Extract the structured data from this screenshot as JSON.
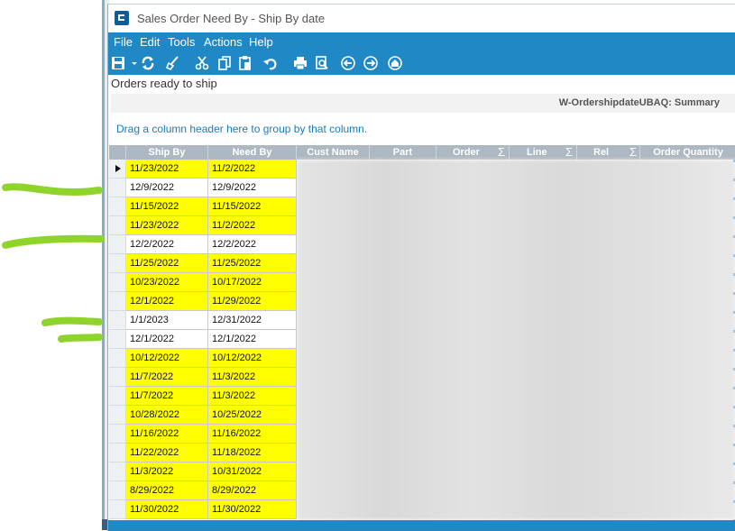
{
  "window": {
    "title": "Sales Order Need By - Ship By date"
  },
  "menu": [
    "File",
    "Edit",
    "Tools",
    "Actions",
    "Help"
  ],
  "toolbar_icons": [
    "save-icon",
    "dropdown-icon",
    "refresh-icon",
    "clear-icon",
    "cut-icon",
    "copy-icon",
    "paste-icon",
    "undo-icon",
    "print-icon",
    "print-preview-icon",
    "back-icon",
    "forward-icon",
    "home-icon"
  ],
  "panel": {
    "orders_label": "Orders ready to ship",
    "summary_label": "W-OrdershipdateUBAQ: Summary",
    "group_hint": "Drag a column header here to group by that column."
  },
  "grid": {
    "columns": [
      "Ship By",
      "Need By",
      "Cust Name",
      "Part",
      "Order",
      "Line",
      "Rel",
      "Order Quantity"
    ],
    "rows": [
      {
        "ship_by": "11/23/2022",
        "need_by": "11/2/2022",
        "highlight": true
      },
      {
        "ship_by": "12/9/2022",
        "need_by": "12/9/2022",
        "highlight": false
      },
      {
        "ship_by": "11/15/2022",
        "need_by": "11/15/2022",
        "highlight": true
      },
      {
        "ship_by": "11/23/2022",
        "need_by": "11/2/2022",
        "highlight": true
      },
      {
        "ship_by": "12/2/2022",
        "need_by": "12/2/2022",
        "highlight": false
      },
      {
        "ship_by": "11/25/2022",
        "need_by": "11/25/2022",
        "highlight": true
      },
      {
        "ship_by": "10/23/2022",
        "need_by": "10/17/2022",
        "highlight": true
      },
      {
        "ship_by": "12/1/2022",
        "need_by": "11/29/2022",
        "highlight": true
      },
      {
        "ship_by": "1/1/2023",
        "need_by": "12/31/2022",
        "highlight": false
      },
      {
        "ship_by": "12/1/2022",
        "need_by": "12/1/2022",
        "highlight": false
      },
      {
        "ship_by": "10/12/2022",
        "need_by": "10/12/2022",
        "highlight": true
      },
      {
        "ship_by": "11/7/2022",
        "need_by": "11/3/2022",
        "highlight": true
      },
      {
        "ship_by": "11/7/2022",
        "need_by": "11/3/2022",
        "highlight": true
      },
      {
        "ship_by": "10/28/2022",
        "need_by": "10/25/2022",
        "highlight": true
      },
      {
        "ship_by": "11/16/2022",
        "need_by": "11/16/2022",
        "highlight": true
      },
      {
        "ship_by": "11/22/2022",
        "need_by": "11/18/2022",
        "highlight": true
      },
      {
        "ship_by": "11/3/2022",
        "need_by": "10/31/2022",
        "highlight": true
      },
      {
        "ship_by": "8/29/2022",
        "need_by": "8/29/2022",
        "highlight": true
      },
      {
        "ship_by": "11/30/2022",
        "need_by": "11/30/2022",
        "highlight": true
      }
    ]
  },
  "colors": {
    "accent": "#1f88c5",
    "highlight": "#ffff00",
    "header_bg": "#aeb8c2",
    "annotation": "#8fd42a"
  }
}
